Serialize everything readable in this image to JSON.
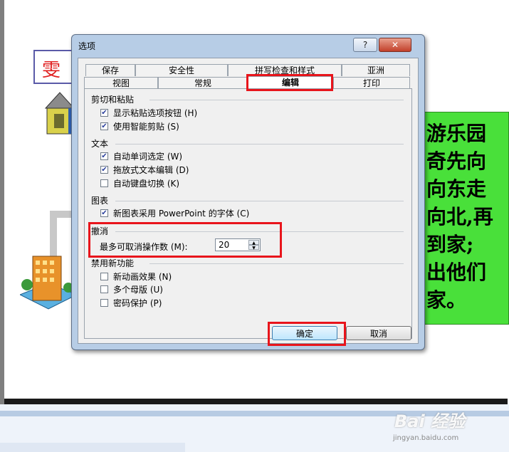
{
  "background": {
    "red_word": "雯",
    "green_box_lines": [
      "游乐园",
      "奇先向",
      "向东走",
      "向北,再",
      "到家;",
      "出他们",
      "家。"
    ]
  },
  "dialog": {
    "title": "选项",
    "help_glyph": "?",
    "close_glyph": "✕",
    "tabs_back": [
      "保存",
      "安全性",
      "拼写检查和样式",
      "亚洲"
    ],
    "tabs_front": [
      "视图",
      "常规",
      "编辑",
      "打印"
    ],
    "active_tab": "编辑",
    "groups": {
      "cut_paste": {
        "title": "剪切和粘贴",
        "options": [
          {
            "label": "显示粘贴选项按钮 (H)",
            "checked": true
          },
          {
            "label": "使用智能剪贴 (S)",
            "checked": true
          }
        ]
      },
      "text": {
        "title": "文本",
        "options": [
          {
            "label": "自动单词选定 (W)",
            "checked": true
          },
          {
            "label": "拖放式文本编辑 (D)",
            "checked": true
          },
          {
            "label": "自动键盘切换 (K)",
            "checked": false
          }
        ]
      },
      "chart": {
        "title": "图表",
        "options": [
          {
            "label": "新图表采用 PowerPoint 的字体 (C)",
            "checked": true
          }
        ]
      },
      "undo": {
        "title": "撤消",
        "max_undo_label": "最多可取消操作数 (M):",
        "max_undo_value": "20"
      },
      "disable_features": {
        "title": "禁用新功能",
        "options": [
          {
            "label": "新动画效果 (N)",
            "checked": false
          },
          {
            "label": "多个母版 (U)",
            "checked": false
          },
          {
            "label": "密码保护 (P)",
            "checked": false
          }
        ]
      }
    },
    "ok_label": "确定",
    "cancel_label": "取消"
  },
  "watermark": {
    "main": "Bai 经验",
    "sub": "jingyan.baidu.com"
  },
  "colors": {
    "highlight": "#e8141b",
    "green_box": "#49e03a",
    "checkmark": "#2a3f9c"
  }
}
